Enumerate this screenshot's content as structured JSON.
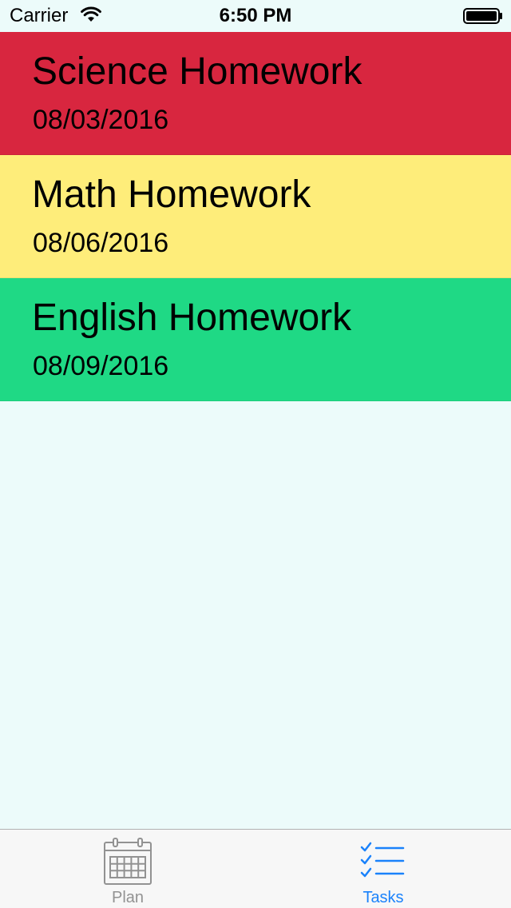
{
  "status_bar": {
    "carrier": "Carrier",
    "time": "6:50 PM"
  },
  "tasks": [
    {
      "title": "Science Homework",
      "date": "08/03/2016",
      "color": "#d8263f"
    },
    {
      "title": "Math Homework",
      "date": "08/06/2016",
      "color": "#feed7a"
    },
    {
      "title": "English Homework",
      "date": "08/09/2016",
      "color": "#1fd985"
    }
  ],
  "tab_bar": {
    "plan": {
      "label": "Plan",
      "icon": "calendar-icon",
      "color": "#929292"
    },
    "tasks": {
      "label": "Tasks",
      "icon": "checklist-icon",
      "color": "#1a82fb",
      "selected": true
    }
  },
  "colors": {
    "background": "#ecfbfa",
    "tab_bar_background": "#f7f7f7"
  }
}
